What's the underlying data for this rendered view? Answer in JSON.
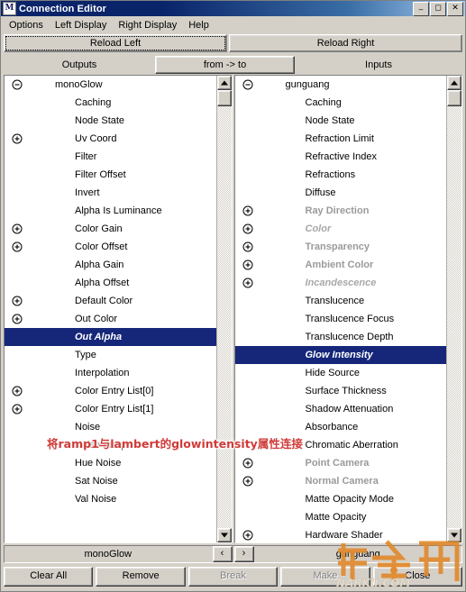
{
  "window": {
    "title": "Connection Editor",
    "icon": "maya-app-icon",
    "buttons": {
      "minimize": "_",
      "maximize": "❑",
      "close": "✕"
    }
  },
  "menubar": {
    "items": [
      {
        "label": "Options"
      },
      {
        "label": "Left Display"
      },
      {
        "label": "Right Display"
      },
      {
        "label": "Help"
      }
    ]
  },
  "toolbar": {
    "reload_left": "Reload Left",
    "reload_right": "Reload Right"
  },
  "header": {
    "outputs": "Outputs",
    "from_to": "from -> to",
    "inputs": "Inputs"
  },
  "left_panel": {
    "root": "monoGlow",
    "rows": [
      {
        "label": "monoGlow",
        "expander": "minus",
        "level": 0,
        "style": "normal",
        "selected": false
      },
      {
        "label": "Caching",
        "expander": "none",
        "level": 1,
        "style": "normal",
        "selected": false
      },
      {
        "label": "Node State",
        "expander": "none",
        "level": 1,
        "style": "normal",
        "selected": false
      },
      {
        "label": "Uv Coord",
        "expander": "plus",
        "level": 1,
        "style": "normal",
        "selected": false
      },
      {
        "label": "Filter",
        "expander": "none",
        "level": 1,
        "style": "normal",
        "selected": false
      },
      {
        "label": "Filter Offset",
        "expander": "none",
        "level": 1,
        "style": "normal",
        "selected": false
      },
      {
        "label": "Invert",
        "expander": "none",
        "level": 1,
        "style": "normal",
        "selected": false
      },
      {
        "label": "Alpha Is Luminance",
        "expander": "none",
        "level": 1,
        "style": "normal",
        "selected": false
      },
      {
        "label": "Color Gain",
        "expander": "plus",
        "level": 1,
        "style": "normal",
        "selected": false
      },
      {
        "label": "Color Offset",
        "expander": "plus",
        "level": 1,
        "style": "normal",
        "selected": false
      },
      {
        "label": "Alpha Gain",
        "expander": "none",
        "level": 1,
        "style": "normal",
        "selected": false
      },
      {
        "label": "Alpha Offset",
        "expander": "none",
        "level": 1,
        "style": "normal",
        "selected": false
      },
      {
        "label": "Default Color",
        "expander": "plus",
        "level": 1,
        "style": "normal",
        "selected": false
      },
      {
        "label": "Out Color",
        "expander": "plus",
        "level": 1,
        "style": "normal",
        "selected": false
      },
      {
        "label": "Out Alpha",
        "expander": "none",
        "level": 1,
        "style": "normal",
        "selected": true
      },
      {
        "label": "Type",
        "expander": "none",
        "level": 1,
        "style": "normal",
        "selected": false
      },
      {
        "label": "Interpolation",
        "expander": "none",
        "level": 1,
        "style": "normal",
        "selected": false
      },
      {
        "label": "Color Entry List[0]",
        "expander": "plus",
        "level": 1,
        "style": "normal",
        "selected": false
      },
      {
        "label": "Color Entry List[1]",
        "expander": "plus",
        "level": 1,
        "style": "normal",
        "selected": false
      },
      {
        "label": "Noise",
        "expander": "none",
        "level": 1,
        "style": "normal",
        "selected": false
      },
      {
        "label": "Noise Freq",
        "expander": "none",
        "level": 1,
        "style": "normal",
        "selected": false
      },
      {
        "label": "Hue Noise",
        "expander": "none",
        "level": 1,
        "style": "normal",
        "selected": false
      },
      {
        "label": "Sat Noise",
        "expander": "none",
        "level": 1,
        "style": "normal",
        "selected": false
      },
      {
        "label": "Val Noise",
        "expander": "none",
        "level": 1,
        "style": "normal",
        "selected": false
      }
    ]
  },
  "right_panel": {
    "root": "gunguang",
    "rows": [
      {
        "label": "gunguang",
        "expander": "minus",
        "level": 0,
        "style": "normal",
        "selected": false
      },
      {
        "label": "Caching",
        "expander": "none",
        "level": 1,
        "style": "normal",
        "selected": false
      },
      {
        "label": "Node State",
        "expander": "none",
        "level": 1,
        "style": "normal",
        "selected": false
      },
      {
        "label": "Refraction Limit",
        "expander": "none",
        "level": 1,
        "style": "normal",
        "selected": false
      },
      {
        "label": "Refractive Index",
        "expander": "none",
        "level": 1,
        "style": "normal",
        "selected": false
      },
      {
        "label": "Refractions",
        "expander": "none",
        "level": 1,
        "style": "normal",
        "selected": false
      },
      {
        "label": "Diffuse",
        "expander": "none",
        "level": 1,
        "style": "normal",
        "selected": false
      },
      {
        "label": "Ray Direction",
        "expander": "plus",
        "level": 1,
        "style": "dim",
        "selected": false
      },
      {
        "label": "Color",
        "expander": "plus",
        "level": 1,
        "style": "italic",
        "selected": false
      },
      {
        "label": "Transparency",
        "expander": "plus",
        "level": 1,
        "style": "dim",
        "selected": false
      },
      {
        "label": "Ambient Color",
        "expander": "plus",
        "level": 1,
        "style": "dim",
        "selected": false
      },
      {
        "label": "Incandescence",
        "expander": "plus",
        "level": 1,
        "style": "italic",
        "selected": false
      },
      {
        "label": "Translucence",
        "expander": "none",
        "level": 1,
        "style": "normal",
        "selected": false
      },
      {
        "label": "Translucence Focus",
        "expander": "none",
        "level": 1,
        "style": "normal",
        "selected": false
      },
      {
        "label": "Translucence Depth",
        "expander": "none",
        "level": 1,
        "style": "normal",
        "selected": false
      },
      {
        "label": "Glow Intensity",
        "expander": "none",
        "level": 1,
        "style": "normal",
        "selected": true
      },
      {
        "label": "Hide Source",
        "expander": "none",
        "level": 1,
        "style": "normal",
        "selected": false
      },
      {
        "label": "Surface Thickness",
        "expander": "none",
        "level": 1,
        "style": "normal",
        "selected": false
      },
      {
        "label": "Shadow Attenuation",
        "expander": "none",
        "level": 1,
        "style": "normal",
        "selected": false
      },
      {
        "label": "Absorbance",
        "expander": "none",
        "level": 1,
        "style": "normal",
        "selected": false
      },
      {
        "label": "Chromatic Aberration",
        "expander": "none",
        "level": 1,
        "style": "normal",
        "selected": false
      },
      {
        "label": "Point Camera",
        "expander": "plus",
        "level": 1,
        "style": "dim",
        "selected": false
      },
      {
        "label": "Normal Camera",
        "expander": "plus",
        "level": 1,
        "style": "dim",
        "selected": false
      },
      {
        "label": "Matte Opacity Mode",
        "expander": "none",
        "level": 1,
        "style": "normal",
        "selected": false
      },
      {
        "label": "Matte Opacity",
        "expander": "none",
        "level": 1,
        "style": "normal",
        "selected": false
      },
      {
        "label": "Hardware Shader",
        "expander": "plus",
        "level": 1,
        "style": "normal",
        "selected": false
      }
    ]
  },
  "annotation": {
    "text": "将ramp1与lambert的glowintensity属性连接",
    "color": "#cf3b38"
  },
  "namebar": {
    "left_name": "monoGlow",
    "prev": "‹",
    "next": "›",
    "right_name": "gunguang"
  },
  "actions": [
    {
      "label": "Clear All",
      "disabled": false
    },
    {
      "label": "Remove",
      "disabled": false
    },
    {
      "label": "Break",
      "disabled": true
    },
    {
      "label": "Make",
      "disabled": true
    },
    {
      "label": "Close",
      "disabled": false
    }
  ],
  "watermark": {
    "text_cn": "纳金网",
    "text_url": "NARKII.COM",
    "color": "#e08a2e"
  }
}
